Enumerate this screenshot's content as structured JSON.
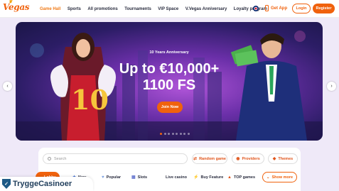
{
  "brand": {
    "logo_text": "Vegas"
  },
  "nav": {
    "items": [
      {
        "label": "Game Hall",
        "active": true
      },
      {
        "label": "Sports",
        "active": false
      },
      {
        "label": "All promotions",
        "active": false
      },
      {
        "label": "Tournaments",
        "active": false
      },
      {
        "label": "VIP Space",
        "active": false
      },
      {
        "label": "V.Vegas Anniversary",
        "active": false
      },
      {
        "label": "Loyalty program",
        "active": false
      }
    ]
  },
  "header": {
    "get_app": "Get App",
    "login": "Login",
    "register": "Register"
  },
  "hero": {
    "subtitle": "10 Years Anniversary",
    "line1": "Up to €10,000+",
    "line2": "1100 FS",
    "cta": "Join Now",
    "slide_count": 8,
    "active_slide": 0
  },
  "search": {
    "placeholder": "Search"
  },
  "pills": [
    {
      "label": "Random game",
      "icon": "shuffle-icon"
    },
    {
      "label": "Providers",
      "icon": "providers-icon"
    },
    {
      "label": "Themes",
      "icon": "themes-icon"
    }
  ],
  "categories": [
    {
      "label": "Lobby",
      "icon": "lobby-icon",
      "active": true
    },
    {
      "label": "New",
      "icon": "new-icon"
    },
    {
      "label": "Popular",
      "icon": "heart-icon"
    },
    {
      "label": "Slots",
      "icon": "slots-icon"
    },
    {
      "label": "Live casino",
      "icon": "live-icon"
    },
    {
      "label": "Buy Feature",
      "icon": "buy-feature-icon"
    },
    {
      "label": "TOP games",
      "icon": "top-icon"
    }
  ],
  "show_more": "Show more",
  "badge": {
    "name": "TryggeCasinoer"
  },
  "colors": {
    "accent": "#f0620d",
    "text": "#2a2d3f"
  }
}
